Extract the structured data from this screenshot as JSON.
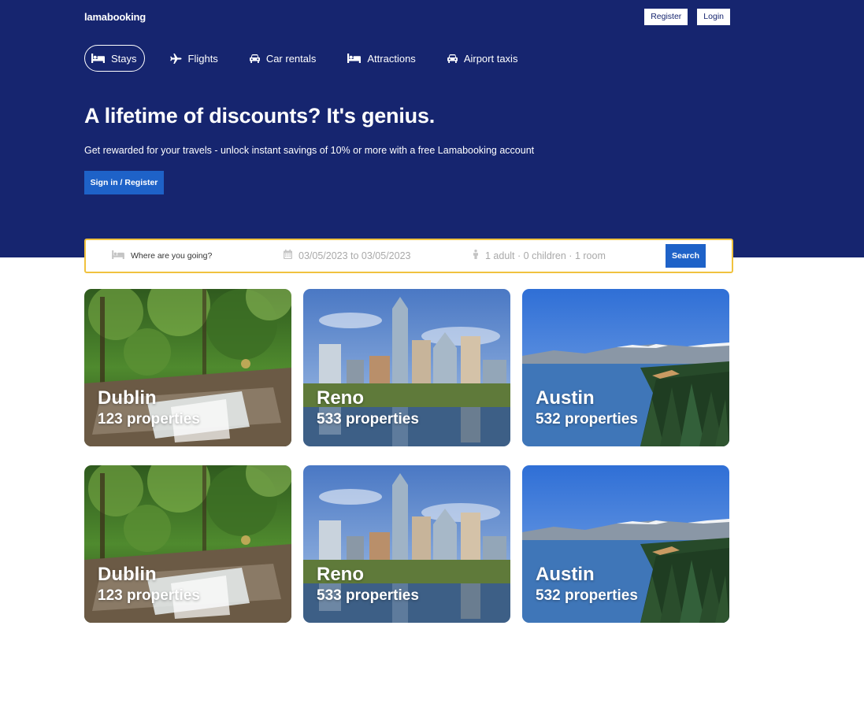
{
  "header": {
    "logo": "lamabooking",
    "register_label": "Register",
    "login_label": "Login"
  },
  "tabs": [
    {
      "label": "Stays",
      "icon": "bed-icon",
      "active": true
    },
    {
      "label": "Flights",
      "icon": "plane-icon",
      "active": false
    },
    {
      "label": "Car rentals",
      "icon": "car-icon",
      "active": false
    },
    {
      "label": "Attractions",
      "icon": "bed-icon",
      "active": false
    },
    {
      "label": "Airport taxis",
      "icon": "taxi-icon",
      "active": false
    }
  ],
  "hero": {
    "title": "A lifetime of discounts? It's genius.",
    "subtitle": "Get rewarded for your travels - unlock instant savings of 10% or more with a free Lamabooking account",
    "cta_label": "Sign in / Register"
  },
  "search": {
    "destination_placeholder": "Where are you going?",
    "dates": "03/05/2023 to 03/05/2023",
    "guests": "1 adult · 0 children · 1 room",
    "button_label": "Search"
  },
  "featured": [
    {
      "city": "Dublin",
      "properties": "123 properties",
      "scene": "forest-waterfall"
    },
    {
      "city": "Reno",
      "properties": "533 properties",
      "scene": "city-skyline"
    },
    {
      "city": "Austin",
      "properties": "532 properties",
      "scene": "lake-mountains"
    },
    {
      "city": "Dublin",
      "properties": "123 properties",
      "scene": "forest-waterfall"
    },
    {
      "city": "Reno",
      "properties": "533 properties",
      "scene": "city-skyline"
    },
    {
      "city": "Austin",
      "properties": "532 properties",
      "scene": "lake-mountains"
    }
  ],
  "colors": {
    "hero_bg": "#16256f",
    "primary_button": "#1e62c8",
    "search_border": "#f0c23e"
  }
}
